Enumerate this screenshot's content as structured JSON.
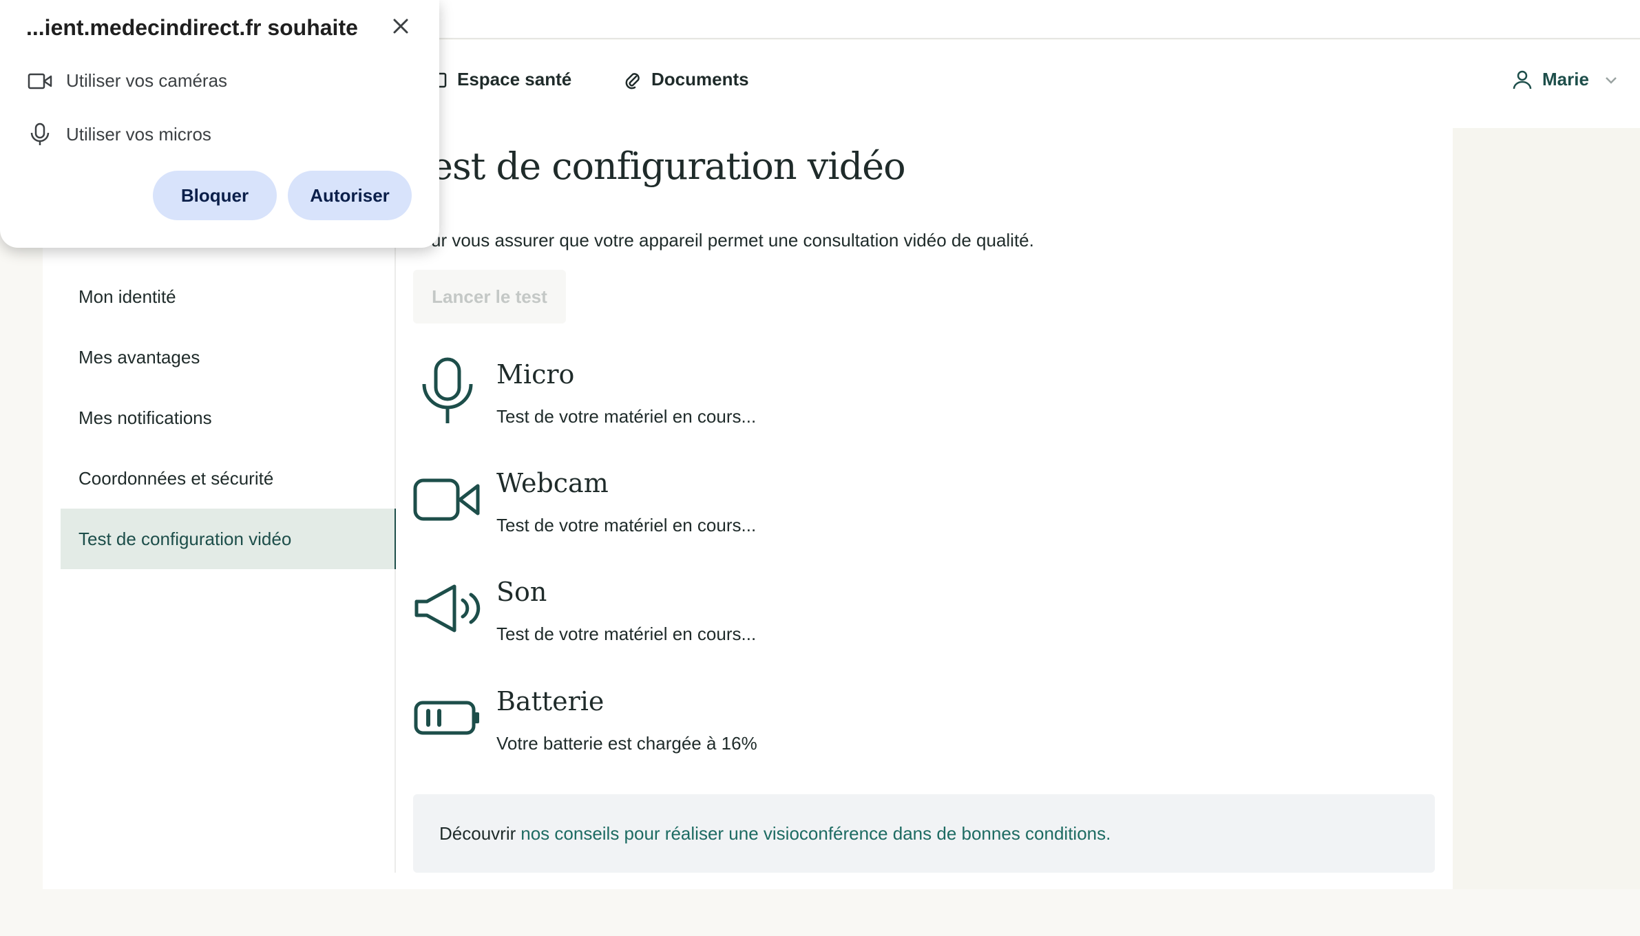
{
  "header": {
    "nav": [
      {
        "label": "Espace santé",
        "icon": "calendar-icon"
      },
      {
        "label": "Documents",
        "icon": "paperclip-icon"
      }
    ],
    "user": {
      "name": "Marie",
      "icon": "user-icon"
    }
  },
  "sidebar": {
    "items": [
      {
        "label": "Mon identité"
      },
      {
        "label": "Mes avantages"
      },
      {
        "label": "Mes notifications"
      },
      {
        "label": "Coordonnées et sécurité"
      },
      {
        "label": "Test de configuration vidéo",
        "active": true
      }
    ]
  },
  "main": {
    "title": "est de configuration vidéo",
    "intro": "ur vous assurer que votre appareil permet une consultation vidéo de qualité.",
    "launch_button": "Lancer le test",
    "tests": [
      {
        "name": "Micro",
        "status": "Test de votre matériel en cours...",
        "icon": "microphone-icon"
      },
      {
        "name": "Webcam",
        "status": "Test de votre matériel en cours...",
        "icon": "video-camera-icon"
      },
      {
        "name": "Son",
        "status": "Test de votre matériel en cours...",
        "icon": "speaker-icon"
      },
      {
        "name": "Batterie",
        "status": "Votre batterie est chargée à 16%",
        "icon": "battery-icon"
      }
    ],
    "tips": {
      "prefix": "Découvrir",
      "link": "nos conseils pour réaliser une visioconférence dans de bonnes conditions."
    }
  },
  "permission_popup": {
    "title": "...ient.medecindirect.fr souhaite",
    "permissions": [
      {
        "label": "Utiliser vos caméras",
        "icon": "camera-icon"
      },
      {
        "label": "Utiliser vos micros",
        "icon": "microphone-icon"
      }
    ],
    "block_label": "Bloquer",
    "allow_label": "Autoriser"
  },
  "colors": {
    "accent": "#1d4e4a",
    "link": "#1d6b62",
    "popup_button": "#d8e3fb",
    "active_bg": "#e3ebe6"
  }
}
